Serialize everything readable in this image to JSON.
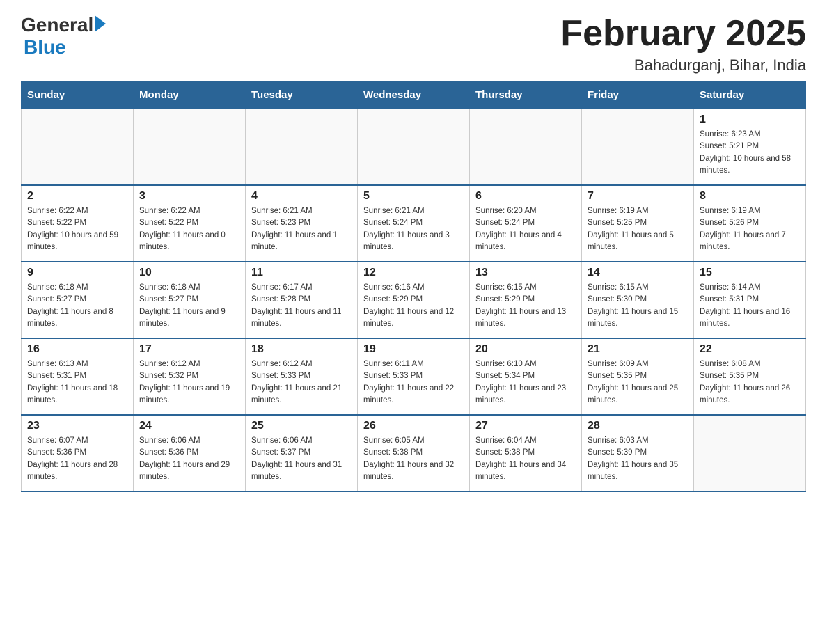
{
  "header": {
    "logo_general": "General",
    "logo_blue": "Blue",
    "month_title": "February 2025",
    "location": "Bahadurganj, Bihar, India"
  },
  "days_of_week": [
    "Sunday",
    "Monday",
    "Tuesday",
    "Wednesday",
    "Thursday",
    "Friday",
    "Saturday"
  ],
  "weeks": [
    [
      {
        "day": "",
        "info": ""
      },
      {
        "day": "",
        "info": ""
      },
      {
        "day": "",
        "info": ""
      },
      {
        "day": "",
        "info": ""
      },
      {
        "day": "",
        "info": ""
      },
      {
        "day": "",
        "info": ""
      },
      {
        "day": "1",
        "info": "Sunrise: 6:23 AM\nSunset: 5:21 PM\nDaylight: 10 hours and 58 minutes."
      }
    ],
    [
      {
        "day": "2",
        "info": "Sunrise: 6:22 AM\nSunset: 5:22 PM\nDaylight: 10 hours and 59 minutes."
      },
      {
        "day": "3",
        "info": "Sunrise: 6:22 AM\nSunset: 5:22 PM\nDaylight: 11 hours and 0 minutes."
      },
      {
        "day": "4",
        "info": "Sunrise: 6:21 AM\nSunset: 5:23 PM\nDaylight: 11 hours and 1 minute."
      },
      {
        "day": "5",
        "info": "Sunrise: 6:21 AM\nSunset: 5:24 PM\nDaylight: 11 hours and 3 minutes."
      },
      {
        "day": "6",
        "info": "Sunrise: 6:20 AM\nSunset: 5:24 PM\nDaylight: 11 hours and 4 minutes."
      },
      {
        "day": "7",
        "info": "Sunrise: 6:19 AM\nSunset: 5:25 PM\nDaylight: 11 hours and 5 minutes."
      },
      {
        "day": "8",
        "info": "Sunrise: 6:19 AM\nSunset: 5:26 PM\nDaylight: 11 hours and 7 minutes."
      }
    ],
    [
      {
        "day": "9",
        "info": "Sunrise: 6:18 AM\nSunset: 5:27 PM\nDaylight: 11 hours and 8 minutes."
      },
      {
        "day": "10",
        "info": "Sunrise: 6:18 AM\nSunset: 5:27 PM\nDaylight: 11 hours and 9 minutes."
      },
      {
        "day": "11",
        "info": "Sunrise: 6:17 AM\nSunset: 5:28 PM\nDaylight: 11 hours and 11 minutes."
      },
      {
        "day": "12",
        "info": "Sunrise: 6:16 AM\nSunset: 5:29 PM\nDaylight: 11 hours and 12 minutes."
      },
      {
        "day": "13",
        "info": "Sunrise: 6:15 AM\nSunset: 5:29 PM\nDaylight: 11 hours and 13 minutes."
      },
      {
        "day": "14",
        "info": "Sunrise: 6:15 AM\nSunset: 5:30 PM\nDaylight: 11 hours and 15 minutes."
      },
      {
        "day": "15",
        "info": "Sunrise: 6:14 AM\nSunset: 5:31 PM\nDaylight: 11 hours and 16 minutes."
      }
    ],
    [
      {
        "day": "16",
        "info": "Sunrise: 6:13 AM\nSunset: 5:31 PM\nDaylight: 11 hours and 18 minutes."
      },
      {
        "day": "17",
        "info": "Sunrise: 6:12 AM\nSunset: 5:32 PM\nDaylight: 11 hours and 19 minutes."
      },
      {
        "day": "18",
        "info": "Sunrise: 6:12 AM\nSunset: 5:33 PM\nDaylight: 11 hours and 21 minutes."
      },
      {
        "day": "19",
        "info": "Sunrise: 6:11 AM\nSunset: 5:33 PM\nDaylight: 11 hours and 22 minutes."
      },
      {
        "day": "20",
        "info": "Sunrise: 6:10 AM\nSunset: 5:34 PM\nDaylight: 11 hours and 23 minutes."
      },
      {
        "day": "21",
        "info": "Sunrise: 6:09 AM\nSunset: 5:35 PM\nDaylight: 11 hours and 25 minutes."
      },
      {
        "day": "22",
        "info": "Sunrise: 6:08 AM\nSunset: 5:35 PM\nDaylight: 11 hours and 26 minutes."
      }
    ],
    [
      {
        "day": "23",
        "info": "Sunrise: 6:07 AM\nSunset: 5:36 PM\nDaylight: 11 hours and 28 minutes."
      },
      {
        "day": "24",
        "info": "Sunrise: 6:06 AM\nSunset: 5:36 PM\nDaylight: 11 hours and 29 minutes."
      },
      {
        "day": "25",
        "info": "Sunrise: 6:06 AM\nSunset: 5:37 PM\nDaylight: 11 hours and 31 minutes."
      },
      {
        "day": "26",
        "info": "Sunrise: 6:05 AM\nSunset: 5:38 PM\nDaylight: 11 hours and 32 minutes."
      },
      {
        "day": "27",
        "info": "Sunrise: 6:04 AM\nSunset: 5:38 PM\nDaylight: 11 hours and 34 minutes."
      },
      {
        "day": "28",
        "info": "Sunrise: 6:03 AM\nSunset: 5:39 PM\nDaylight: 11 hours and 35 minutes."
      },
      {
        "day": "",
        "info": ""
      }
    ]
  ]
}
